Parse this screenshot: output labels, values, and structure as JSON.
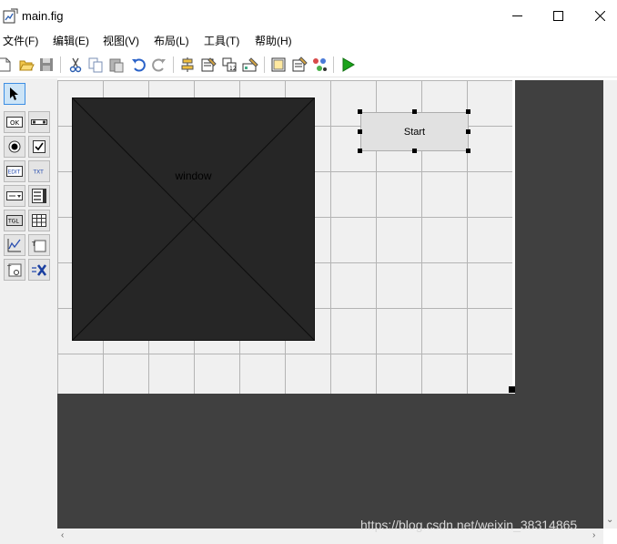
{
  "window": {
    "title": "main.fig"
  },
  "menu": {
    "file": "文件(F)",
    "edit": "编辑(E)",
    "view": "视图(V)",
    "layout": "布局(L)",
    "tools": "工具(T)",
    "help": "帮助(H)"
  },
  "palette": {
    "items": [
      "select",
      "push-button",
      "slider",
      "radio-button",
      "check-box",
      "edit-text",
      "static-text",
      "popup-menu",
      "list-box",
      "toggle-button",
      "table",
      "axes",
      "panel",
      "button-group",
      "activex-control"
    ],
    "edit_glyph": "EDIT",
    "text_glyph": "TXT",
    "ok_glyph": "OK",
    "tgl_glyph": "TGL"
  },
  "canvas": {
    "axes_label": "window",
    "button_label": "Start"
  },
  "watermark": "https://blog.csdn.net/weixin_38314865",
  "colors": {
    "canvas_bg": "#404040",
    "grid_bg": "#f0f0f0",
    "axes_bg": "#262626",
    "run_green": "#1aa31a"
  }
}
